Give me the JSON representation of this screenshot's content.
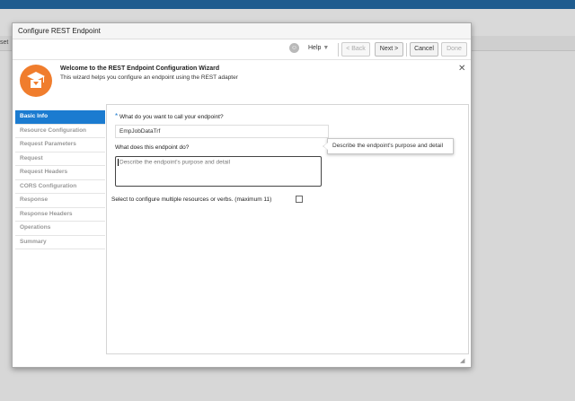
{
  "background": {
    "fragment": "set"
  },
  "dialog": {
    "title": "Configure REST Endpoint"
  },
  "toolbar": {
    "help_label": "Help",
    "back_label": "< Back",
    "next_label": "Next >",
    "cancel_label": "Cancel",
    "done_label": "Done"
  },
  "welcome": {
    "title": "Welcome to the REST Endpoint Configuration Wizard",
    "subtitle": "This wizard helps you configure an endpoint using the REST adapter"
  },
  "nav": {
    "items": [
      {
        "label": "Basic Info",
        "active": true
      },
      {
        "label": "Resource Configuration",
        "active": false
      },
      {
        "label": "Request Parameters",
        "active": false
      },
      {
        "label": "Request",
        "active": false
      },
      {
        "label": "Request Headers",
        "active": false
      },
      {
        "label": "CORS Configuration",
        "active": false
      },
      {
        "label": "Response",
        "active": false
      },
      {
        "label": "Response Headers",
        "active": false
      },
      {
        "label": "Operations",
        "active": false
      },
      {
        "label": "Summary",
        "active": false
      }
    ]
  },
  "form": {
    "required_marker": "*",
    "name_label": "What do you want to call your endpoint?",
    "name_value": "EmpJobDataTrf",
    "desc_label": "What does this endpoint do?",
    "desc_placeholder": "Describe the endpoint's purpose and detail",
    "tooltip": "Describe the endpoint's purpose and detail",
    "multi_label": "Select to configure multiple resources or verbs. (maximum 11)",
    "multi_checked": false
  },
  "colors": {
    "accent": "#1b7bd0",
    "logo": "#f07d2d",
    "topbar": "#1f5c8f"
  },
  "icons": {
    "help": "user-help-icon",
    "logo": "graduation-cap-icon",
    "close": "close-icon",
    "resize": "resize-grip-icon"
  }
}
